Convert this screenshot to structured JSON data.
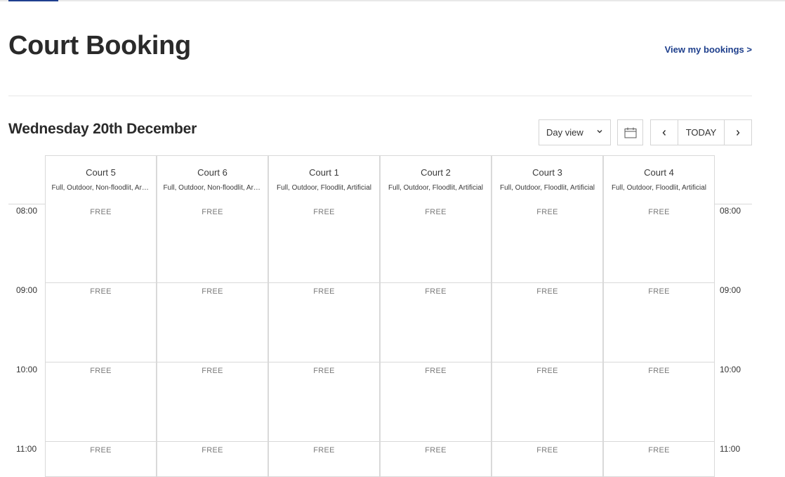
{
  "header": {
    "title": "Court Booking",
    "view_bookings_link": "View my bookings >"
  },
  "toolbar": {
    "date": "Wednesday 20th December",
    "view_select": "Day view",
    "today_label": "TODAY"
  },
  "courts": [
    {
      "name": "Court 5",
      "desc": "Full, Outdoor, Non-floodlit, Artificial"
    },
    {
      "name": "Court 6",
      "desc": "Full, Outdoor, Non-floodlit, Artificial"
    },
    {
      "name": "Court 1",
      "desc": "Full, Outdoor, Floodlit, Artificial"
    },
    {
      "name": "Court 2",
      "desc": "Full, Outdoor, Floodlit, Artificial"
    },
    {
      "name": "Court 3",
      "desc": "Full, Outdoor, Floodlit, Artificial"
    },
    {
      "name": "Court 4",
      "desc": "Full, Outdoor, Floodlit, Artificial"
    }
  ],
  "times": [
    "08:00",
    "09:00",
    "10:00",
    "11:00"
  ],
  "slot_status": "FREE",
  "colors": {
    "accent": "#1e3f8c",
    "border": "#d9d9d9",
    "text": "#2a2a2a",
    "muted": "#7a7a7a"
  }
}
